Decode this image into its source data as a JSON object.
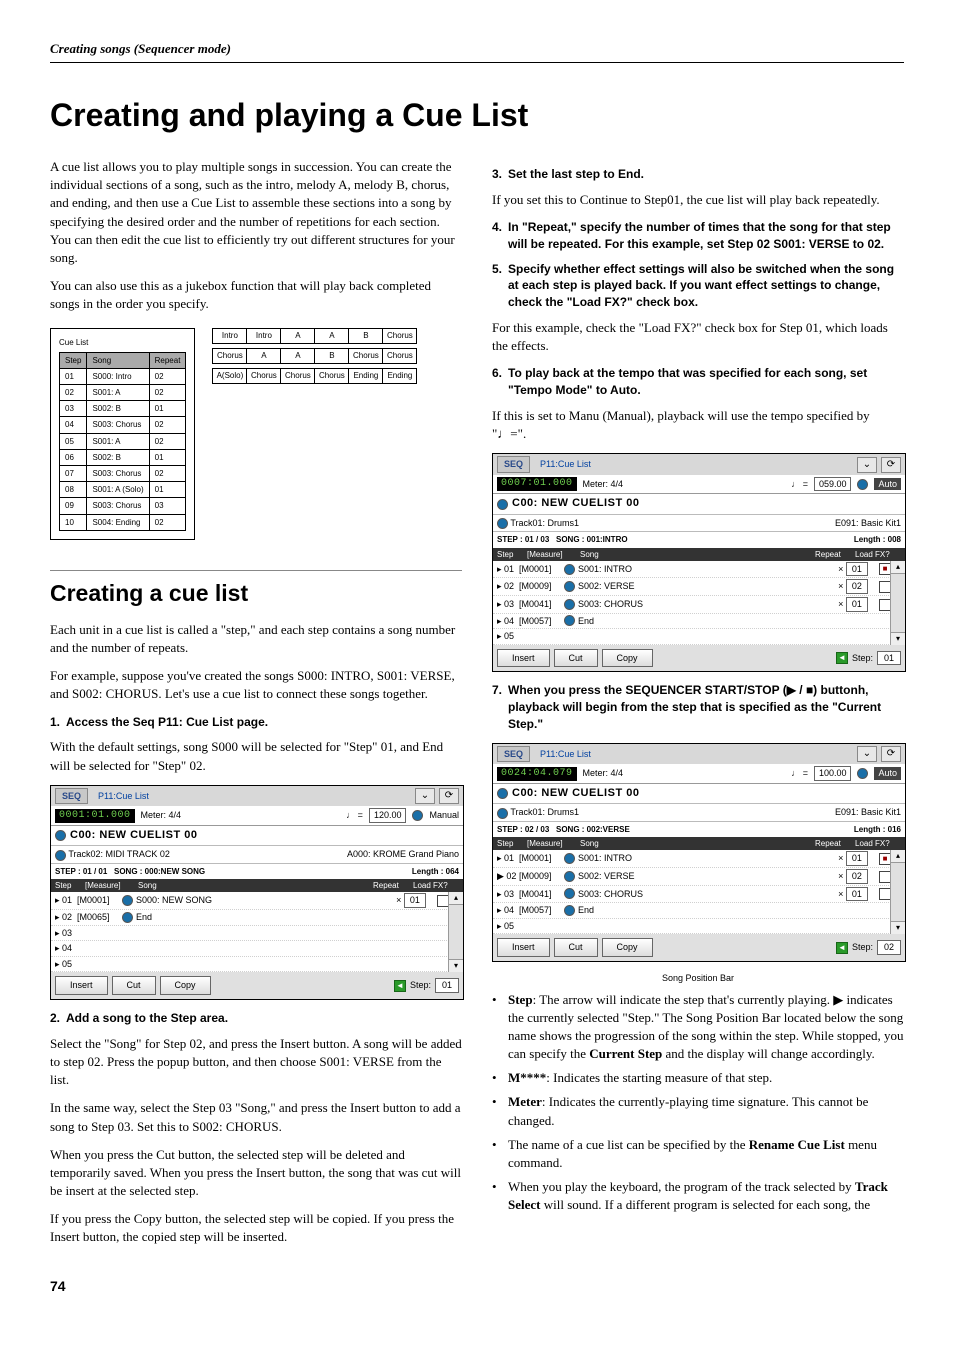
{
  "header": "Creating songs (Sequencer mode)",
  "h1": "Creating and playing a Cue List",
  "intro_p1": "A cue list allows you to play multiple songs in succession. You can create the individual sections of a song, such as the intro, melody A, melody B, chorus, and ending, and then use a Cue List to assemble these sections into a song by specifying the desired order and the number of repetitions for each section. You can then edit the cue list to efficiently try out different structures for your song.",
  "intro_p2": "You can also use this as a jukebox function that will play back completed songs in the order you specify.",
  "cuelist_label": "Cue List",
  "cuelist_headers": [
    "Step",
    "Song",
    "Repeat"
  ],
  "cuelist_rows": [
    [
      "01",
      "S000: Intro",
      "02"
    ],
    [
      "02",
      "S001: A",
      "02"
    ],
    [
      "03",
      "S002: B",
      "01"
    ],
    [
      "04",
      "S003: Chorus",
      "02"
    ],
    [
      "05",
      "S001: A",
      "02"
    ],
    [
      "06",
      "S002: B",
      "01"
    ],
    [
      "07",
      "S003: Chorus",
      "02"
    ],
    [
      "08",
      "S001: A (Solo)",
      "01"
    ],
    [
      "09",
      "S003: Chorus",
      "03"
    ],
    [
      "10",
      "S004: Ending",
      "02"
    ]
  ],
  "songgrid": [
    [
      "Intro",
      "Intro",
      "A",
      "A",
      "B",
      "Chorus"
    ],
    [
      "Chorus",
      "A",
      "A",
      "B",
      "Chorus",
      "Chorus"
    ],
    [
      "A(Solo)",
      "Chorus",
      "Chorus",
      "Chorus",
      "Ending",
      "Ending"
    ]
  ],
  "h2": "Creating a cue list",
  "creating_p1": "Each unit in a cue list is called a \"step,\" and each step contains a song number and the number of repeats.",
  "creating_p2": "For example, suppose you've created the songs S000: INTRO, S001: VERSE, and S002: CHORUS. Let's use a cue list to connect these songs together.",
  "steps_left": {
    "s1": "Access the Seq P11: Cue List page.",
    "s1_note": "With the default settings, song S000 will be selected for \"Step\" 01, and End will be selected for \"Step\" 02.",
    "s2": "Add a song to the Step area.",
    "s2_p1": "Select the \"Song\" for Step 02, and press the Insert button. A song will be added to step 02. Press the popup button, and then choose S001: VERSE from the list.",
    "s2_p2": "In the same way, select the Step 03 \"Song,\" and press the Insert button to add a song to Step 03. Set this to S002: CHORUS.",
    "s2_p3": "When you press the Cut button, the selected step will be deleted and temporarily saved. When you press the Insert button, the song that was cut will be insert at the selected step.",
    "s2_p4": "If you press the Copy button, the selected step will be copied. If you press the Insert button, the copied step will be inserted."
  },
  "steps_right": {
    "s3": "Set the last step to End.",
    "s3_note": "If you set this to Continue to Step01, the cue list will play back repeatedly.",
    "s4": "In \"Repeat,\" specify the number of times that the song for that step will be repeated. For this example, set Step 02 S001: VERSE to 02.",
    "s5": "Specify whether effect settings will also be switched when the song at each step is played back. If you want effect settings to change, check the \"Load FX?\" check box.",
    "s5_note": "For this example, check the \"Load FX?\" check box for Step 01, which loads the effects.",
    "s6": "To play back at the tempo that was specified for each song, set \"Tempo Mode\" to Auto.",
    "s6_note": "If this is set to Manu (Manual), playback will use the tempo specified by \"♩=\".",
    "s7": "When you press the SEQUENCER START/STOP (▶ / ■) buttonh, playback will begin from the step that is specified as the \"Current Step.\""
  },
  "screen_a": {
    "seq": "SEQ",
    "title": "P11:Cue List",
    "counter": "0001:01.000",
    "meter": "Meter:  4/4",
    "tempo_val": "120.00",
    "tempo_mode": "Manual",
    "name": "C00: NEW CUELIST 00",
    "track": "Track02: MIDI TRACK 02",
    "prog": "A000: KROME Grand Piano",
    "step_info": "STEP : 01 / 01",
    "song_info": "SONG : 000:NEW SONG",
    "length_info": "Length : 064",
    "list_headers": {
      "step": "Step",
      "measure": "[Measure]",
      "song": "Song",
      "repeat": "Repeat",
      "loadfx": "Load FX?"
    },
    "rows": [
      {
        "step": "▸ 01",
        "measure": "[M0001]",
        "song": "S000: NEW SONG",
        "repeat": "01",
        "fx": false
      },
      {
        "step": "▸ 02",
        "measure": "[M0065]",
        "song": "End",
        "repeat": "",
        "fx": null
      },
      {
        "step": "▸ 03",
        "measure": "",
        "song": "",
        "repeat": "",
        "fx": null
      },
      {
        "step": "▸ 04",
        "measure": "",
        "song": "",
        "repeat": "",
        "fx": null
      },
      {
        "step": "▸ 05",
        "measure": "",
        "song": "",
        "repeat": "",
        "fx": null
      }
    ],
    "btns": {
      "insert": "Insert",
      "cut": "Cut",
      "copy": "Copy",
      "step_label": "Step:",
      "step_val": "01"
    }
  },
  "screen_b": {
    "seq": "SEQ",
    "title": "P11:Cue List",
    "counter": "0007:01.000",
    "meter": "Meter:  4/4",
    "tempo_val": "059.00",
    "tempo_mode": "Auto",
    "name": "C00: NEW CUELIST 00",
    "track": "Track01: Drums1",
    "prog": "E091: Basic Kit1",
    "step_info": "STEP : 01 / 03",
    "song_info": "SONG : 001:INTRO",
    "length_info": "Length : 008",
    "rows": [
      {
        "step": "▸ 01",
        "measure": "[M0001]",
        "song": "S001: INTRO",
        "repeat": "01",
        "fx": true
      },
      {
        "step": "▸ 02",
        "measure": "[M0009]",
        "song": "S002: VERSE",
        "repeat": "02",
        "fx": false
      },
      {
        "step": "▸ 03",
        "measure": "[M0041]",
        "song": "S003: CHORUS",
        "repeat": "01",
        "fx": false
      },
      {
        "step": "▸ 04",
        "measure": "[M0057]",
        "song": "End",
        "repeat": "",
        "fx": null
      },
      {
        "step": "▸ 05",
        "measure": "",
        "song": "",
        "repeat": "",
        "fx": null
      }
    ],
    "btns": {
      "insert": "Insert",
      "cut": "Cut",
      "copy": "Copy",
      "step_label": "Step:",
      "step_val": "01"
    }
  },
  "screen_c": {
    "seq": "SEQ",
    "title": "P11:Cue List",
    "counter": "0024:04.079",
    "meter": "Meter:  4/4",
    "tempo_val": "100.00",
    "tempo_mode": "Auto",
    "name": "C00: NEW CUELIST 00",
    "track": "Track01: Drums1",
    "prog": "E091: Basic Kit1",
    "step_info": "STEP : 02 / 03",
    "song_info": "SONG : 002:VERSE",
    "length_info": "Length : 016",
    "rows": [
      {
        "step": "▸ 01",
        "measure": "[M0001]",
        "song": "S001: INTRO",
        "repeat": "01",
        "fx": true
      },
      {
        "step": "▶ 02",
        "measure": "[M0009]",
        "song": "S002: VERSE",
        "repeat": "02",
        "fx": false
      },
      {
        "step": "▸ 03",
        "measure": "[M0041]",
        "song": "S003: CHORUS",
        "repeat": "01",
        "fx": false
      },
      {
        "step": "▸ 04",
        "measure": "[M0057]",
        "song": "End",
        "repeat": "",
        "fx": null
      },
      {
        "step": "▸ 05",
        "measure": "",
        "song": "",
        "repeat": "",
        "fx": null
      }
    ],
    "btns": {
      "insert": "Insert",
      "cut": "Cut",
      "copy": "Copy",
      "step_label": "Step:",
      "step_val": "02"
    }
  },
  "caption_c": "Song Position Bar",
  "bullets": {
    "b1a": "Step",
    "b1b": ": The arrow will indicate the step that's currently playing. ▶ indicates the currently selected \"Step.\" The Song Position Bar located below the song name shows the progression of the song within the step. While stopped, you can specify the ",
    "b1c": "Current Step",
    "b1d": " and the display will change accordingly.",
    "b2a": "M****",
    "b2b": ": Indicates the starting measure of that step.",
    "b3a": "Meter",
    "b3b": ": Indicates the currently-playing time signature. This cannot be changed.",
    "b4a": "The name of a cue list can be specified by the ",
    "b4b": "Rename Cue List",
    "b4c": " menu command.",
    "b5a": "When you play the keyboard, the program of the track selected by ",
    "b5b": "Track Select",
    "b5c": " will sound. If a different program is selected for each song, the"
  },
  "page_number": "74",
  "quarter_note_eq": "♩ =",
  "times_sym": "×"
}
